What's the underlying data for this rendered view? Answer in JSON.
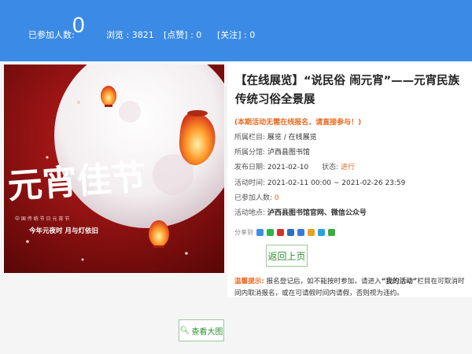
{
  "header": {
    "participants_label": "已参加人数:",
    "participants_count": "0",
    "views": "浏览 : 3821",
    "likes": "[点赞] : 0",
    "follows": "[关注] : 0"
  },
  "poster": {
    "headline": "元宵佳节",
    "small_line": "中 国 传 统 节 日 元 宵 节",
    "tagline": "今年元夜时 月与灯依旧"
  },
  "event": {
    "title": "【在线展览】“说民俗 闹元宵”——元宵民族传统习俗全景展",
    "notice": "(本期活动无需在线报名，请直接参与！)",
    "column_label": "所属栏目:",
    "column_value": "展览 / 在线展览",
    "branch_label": "所属分馆:",
    "branch_value": "泸西县图书馆",
    "publish_label": "发布日期:",
    "publish_value": "2021-02-10",
    "status_label": "状态:",
    "status_value": "进行",
    "time_label": "活动时间:",
    "time_value": "2021-02-11 00:00 ~ 2021-02-26 23:59",
    "joined_label": "已参加人数:",
    "joined_value": "0",
    "place_label": "活动地点:",
    "place_value": "泸西县图书馆官网、微信公众号",
    "share_label": "分享到"
  },
  "buttons": {
    "back": "返回上页",
    "view_large": "查看大图"
  },
  "tip": {
    "label": "温馨提示:",
    "text1": "报名登记后，如不能按时参加，请进入",
    "strong": "“我的活动”",
    "text2": "栏目在可取消时间内取消报名，或在可请假时间内请假，否则视为违约。"
  },
  "colors": {
    "header_blue": "#3b8be6",
    "accent_orange": "#e96a1e",
    "button_green": "#2f8f2f"
  }
}
